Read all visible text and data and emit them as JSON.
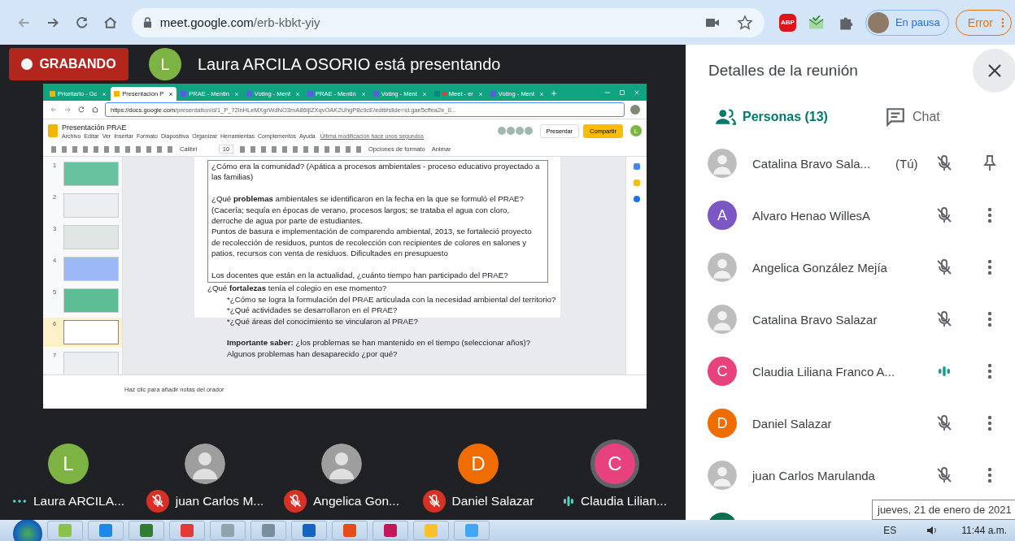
{
  "browser": {
    "url_host": "meet.google.com",
    "url_path": "/erb-kbkt-yiy",
    "adblock_label": "ABP",
    "profile_label": "En pausa",
    "error_label": "Error"
  },
  "meeting": {
    "recording": "GRABANDO",
    "presenter_initial": "L",
    "presenting": "Laura ARCILA OSORIO está presentando"
  },
  "shared_screen": {
    "tabs": [
      {
        "label": "Prioritario - Gc",
        "kind": "drive",
        "selected": false
      },
      {
        "label": "Presentación P",
        "kind": "slides",
        "selected": true
      },
      {
        "label": "PRAE - Mentin",
        "kind": "menti",
        "selected": false
      },
      {
        "label": "Voting - Ment",
        "kind": "menti",
        "selected": false
      },
      {
        "label": "PRAE - Mentin",
        "kind": "menti",
        "selected": false
      },
      {
        "label": "Voting - Ment",
        "kind": "menti",
        "selected": false
      },
      {
        "label": "Meet - er",
        "kind": "meet",
        "selected": false
      },
      {
        "label": "Voting - Ment",
        "kind": "menti",
        "selected": false
      }
    ],
    "url_host": "https://docs.google.com",
    "url_path": "/presentation/d/1_P_72lnHLeMXgrWdNO3mA86tjlZXqvOAK2UhgP8c9cE/edit#slide=id.gae5cffea2e_0...",
    "doc_title": "Presentación PRAE",
    "menus": [
      "Archivo",
      "Editar",
      "Ver",
      "Insertar",
      "Formato",
      "Diapositiva",
      "Organizar",
      "Herramientas",
      "Complementos",
      "Ayuda"
    ],
    "last_edit": "Última modificación hace unos segundos",
    "present": "Presentar",
    "share": "Compartir",
    "user_initial": "L",
    "font": "Calibri",
    "font_size": "10",
    "format_options": "Opciones de formato",
    "animate": "Animar",
    "slides": [
      {
        "number": "1",
        "selected": false
      },
      {
        "number": "2",
        "selected": false
      },
      {
        "number": "3",
        "selected": false
      },
      {
        "number": "4",
        "selected": false
      },
      {
        "number": "5",
        "selected": false
      },
      {
        "number": "6",
        "selected": true
      },
      {
        "number": "7",
        "selected": false
      }
    ],
    "text_box": [
      {
        "spaced": false,
        "indented": false,
        "lines": [
          "¿Cómo era la comunidad? (Apática a procesos ambientales - proceso educativo proyectado a las familias)"
        ]
      },
      {
        "spaced": true,
        "indented": false,
        "lines": [
          "¿Qué **problemas** ambientales se identificaron en la fecha en la que se formuló el PRAE?",
          "(Cacería; sequía en épocas de verano, procesos largos; se trataba el agua con cloro, derroche de agua por parte de estudiantes.",
          "Puntos de basura e implementación de comparendo ambiental, 2013, se fortaleció proyecto de recolección de residuos, puntos de recolección con recipientes de colores en salones y patios, recursos con venta de residuos. Dificultades en presupuesto"
        ]
      },
      {
        "spaced": true,
        "indented": false,
        "lines": [
          "Los docentes que están en la actualidad, ¿cuánto tiempo han participado del PRAE?"
        ]
      }
    ],
    "below": [
      {
        "spaced": false,
        "indented": false,
        "lines": [
          "¿Qué **fortalezas** tenía el colegio en ese momento?"
        ]
      },
      {
        "spaced": false,
        "indented": true,
        "lines": [
          "*¿Cómo se logra la formulación del PRAE articulada con la necesidad ambiental del territorio?",
          "*¿Qué actividades se desarrollaron en el PRAE?",
          "*¿Qué áreas del conocimiento se vincularon al PRAE?"
        ]
      },
      {
        "spaced": true,
        "indented": true,
        "lines": [
          "**Importante saber:** ¿los problemas se han mantenido en el tiempo (seleccionar años)? Algunos problemas han desaparecido ¿por qué?"
        ]
      }
    ],
    "notes_placeholder": "Haz clic para añadir notas del orador"
  },
  "panel": {
    "title": "Detalles de la reunión",
    "tabs": [
      {
        "label": "Personas (13)",
        "kind": "people",
        "selected": true
      },
      {
        "label": "Chat",
        "kind": "chat",
        "selected": false
      }
    ],
    "people": [
      {
        "name": "Catalina Bravo Sala...",
        "suffix": "(Tú)",
        "avatar": {
          "kind": "photo"
        },
        "mic": {
          "kind": "muted"
        },
        "action": {
          "kind": "pin"
        }
      },
      {
        "name": "Alvaro Henao WillesA",
        "avatar": {
          "kind": "letter",
          "initial": "A",
          "color": "#7b57c6"
        },
        "mic": {
          "kind": "muted"
        },
        "action": {
          "kind": "more"
        }
      },
      {
        "name": "Angelica González Mejía",
        "avatar": {
          "kind": "photo"
        },
        "mic": {
          "kind": "muted"
        },
        "action": {
          "kind": "more"
        }
      },
      {
        "name": "Catalina Bravo Salazar",
        "avatar": {
          "kind": "photo"
        },
        "mic": {
          "kind": "muted"
        },
        "action": {
          "kind": "more"
        }
      },
      {
        "name": "Claudia Liliana Franco A...",
        "avatar": {
          "kind": "letter",
          "initial": "C",
          "color": "#e8427e"
        },
        "mic": {
          "kind": "speaking"
        },
        "action": {
          "kind": "more"
        }
      },
      {
        "name": "Daniel Salazar",
        "avatar": {
          "kind": "letter",
          "initial": "D",
          "color": "#ef6c00"
        },
        "mic": {
          "kind": "muted"
        },
        "action": {
          "kind": "more"
        }
      },
      {
        "name": "juan Carlos Marulanda",
        "avatar": {
          "kind": "photo"
        },
        "mic": {
          "kind": "muted"
        },
        "action": {
          "kind": "more"
        }
      }
    ]
  },
  "tiles": [
    {
      "name": "Laura ARCILA...",
      "avatar": {
        "kind": "letter",
        "initial": "L",
        "color": "#7cb342"
      },
      "status": {
        "kind": "dots"
      },
      "highlighted": false
    },
    {
      "name": "juan Carlos M...",
      "avatar": {
        "kind": "photo"
      },
      "status": {
        "kind": "muted"
      },
      "highlighted": false
    },
    {
      "name": "Angelica Gon...",
      "avatar": {
        "kind": "photo"
      },
      "status": {
        "kind": "muted"
      },
      "highlighted": false
    },
    {
      "name": "Daniel Salazar",
      "avatar": {
        "kind": "letter",
        "initial": "D",
        "color": "#ef6c00"
      },
      "status": {
        "kind": "muted"
      },
      "highlighted": false
    },
    {
      "name": "Claudia Lilian...",
      "avatar": {
        "kind": "letter",
        "initial": "C",
        "color": "#e8427e"
      },
      "status": {
        "kind": "speaking"
      },
      "highlighted": true
    }
  ],
  "taskbar": {
    "language": "ES",
    "time": "11:44 a.m.",
    "tooltip": "jueves, 21 de enero de 2021"
  }
}
